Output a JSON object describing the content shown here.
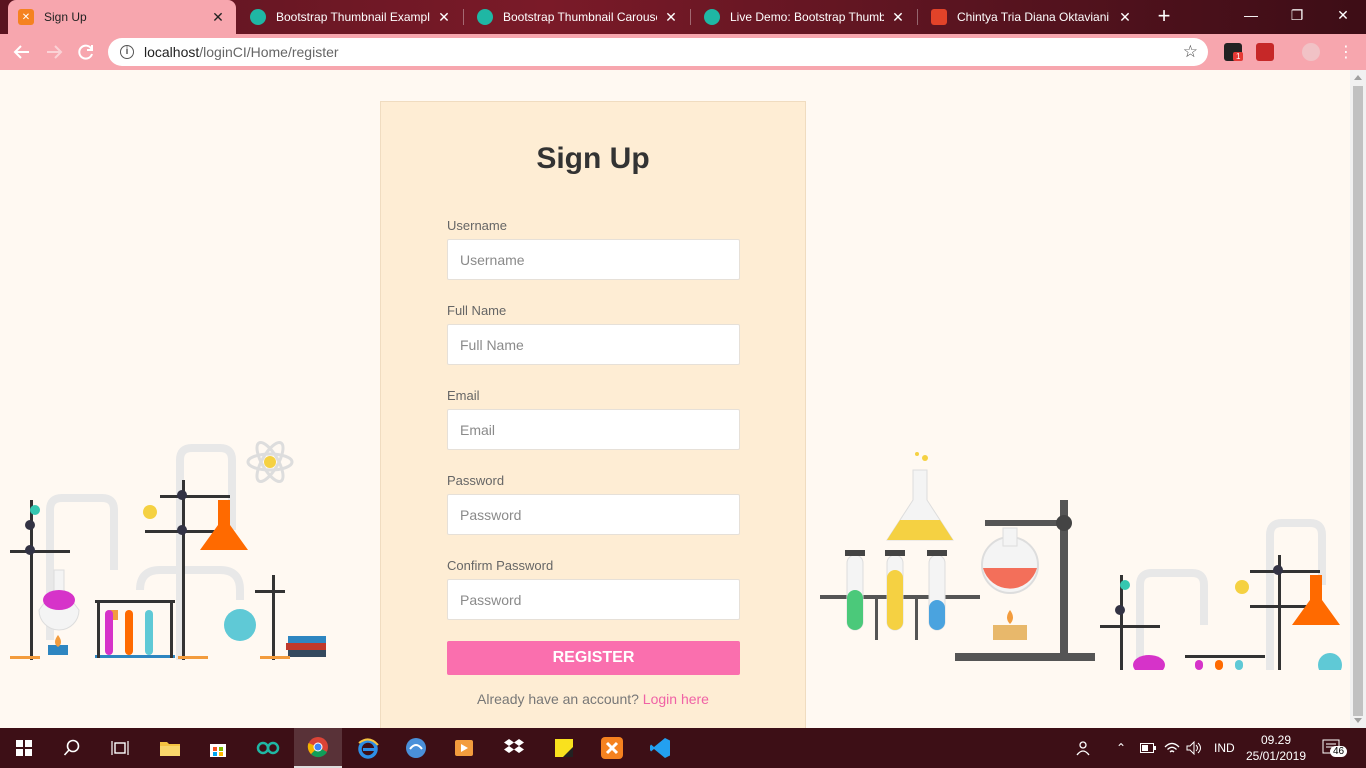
{
  "browser": {
    "tabs": [
      {
        "title": "Sign Up",
        "favicon": "xampp-icon",
        "active": true
      },
      {
        "title": "Bootstrap Thumbnail Examples",
        "favicon": "tutorial-republic-icon",
        "active": false
      },
      {
        "title": "Bootstrap Thumbnail Carousel",
        "favicon": "tutorial-republic-icon",
        "active": false
      },
      {
        "title": "Live Demo: Bootstrap Thumbnail",
        "favicon": "tutorial-republic-icon",
        "active": false
      },
      {
        "title": "Chintya Tria Diana Oktaviani / ",
        "favicon": "gitlab-icon",
        "active": false
      }
    ],
    "new_tab_label": "+",
    "url_host": "localhost",
    "url_path": "/loginCI/Home/register",
    "extension_badge": "1"
  },
  "form": {
    "heading": "Sign Up",
    "fields": [
      {
        "label": "Username",
        "placeholder": "Username",
        "value": ""
      },
      {
        "label": "Full Name",
        "placeholder": "Full Name",
        "value": ""
      },
      {
        "label": "Email",
        "placeholder": "Email",
        "value": ""
      },
      {
        "label": "Password",
        "placeholder": "Password",
        "value": ""
      },
      {
        "label": "Confirm Password",
        "placeholder": "Password",
        "value": ""
      }
    ],
    "submit_label": "REGISTER",
    "login_prompt": "Already have an account?",
    "login_link": "Login here"
  },
  "taskbar": {
    "language": "IND",
    "time": "09.29",
    "date": "25/01/2019",
    "notification_count": "46"
  },
  "colors": {
    "accent": "#fa6fae",
    "card_background": "#feedd4",
    "page_background": "#fff9f2",
    "toolbar": "#f7a6ae",
    "tabstrip": "#5a1420",
    "taskbar": "#3d0f16"
  }
}
